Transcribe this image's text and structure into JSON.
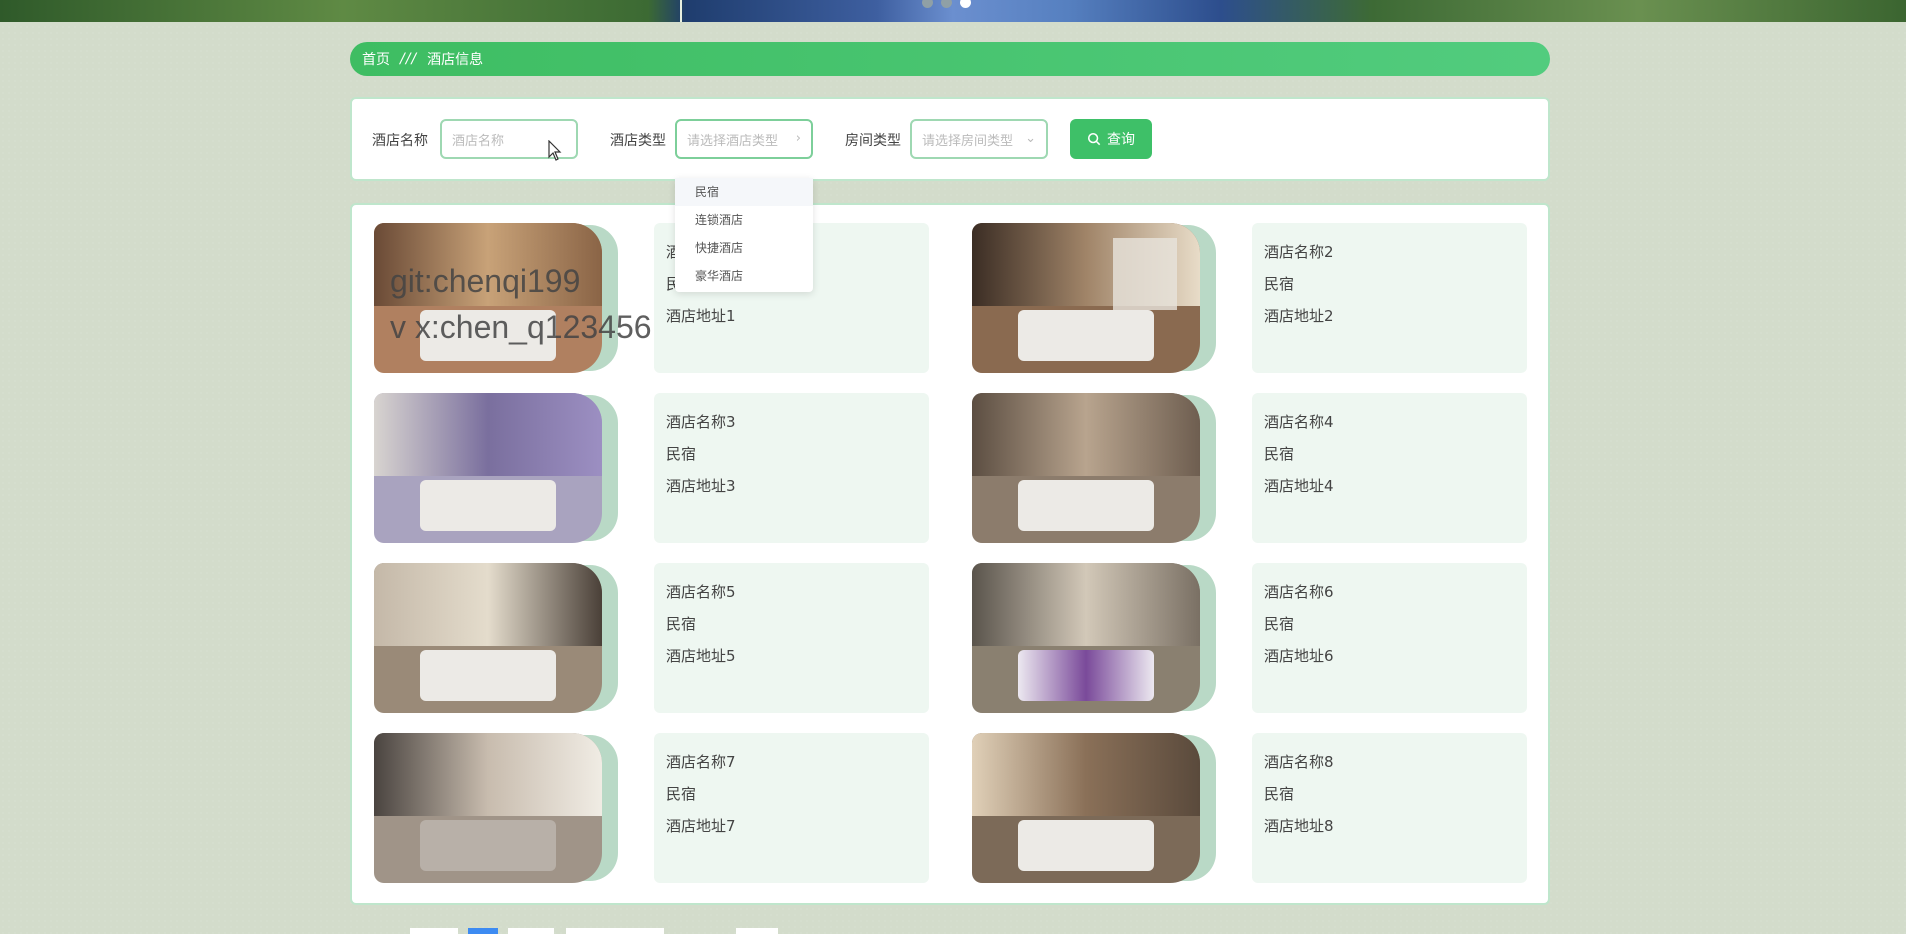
{
  "breadcrumb": {
    "home": "首页",
    "separator": "///",
    "current": "酒店信息"
  },
  "search": {
    "hotel_name_label": "酒店名称",
    "hotel_name_placeholder": "酒店名称",
    "hotel_type_label": "酒店类型",
    "hotel_type_placeholder": "请选择酒店类型",
    "room_type_label": "房间类型",
    "room_type_placeholder": "请选择房间类型",
    "query_button": "查询"
  },
  "hotel_type_options": [
    "民宿",
    "连锁酒店",
    "快捷酒店",
    "豪华酒店"
  ],
  "watermark": {
    "line1": "git:chenqi199",
    "line2": "v x:chen_q123456"
  },
  "hotels": [
    {
      "name": "酒店名称1",
      "type": "民宿",
      "address": "酒店地址1"
    },
    {
      "name": "酒店名称2",
      "type": "民宿",
      "address": "酒店地址2"
    },
    {
      "name": "酒店名称3",
      "type": "民宿",
      "address": "酒店地址3"
    },
    {
      "name": "酒店名称4",
      "type": "民宿",
      "address": "酒店地址4"
    },
    {
      "name": "酒店名称5",
      "type": "民宿",
      "address": "酒店地址5"
    },
    {
      "name": "酒店名称6",
      "type": "民宿",
      "address": "酒店地址6"
    },
    {
      "name": "酒店名称7",
      "type": "民宿",
      "address": "酒店地址7"
    },
    {
      "name": "酒店名称8",
      "type": "民宿",
      "address": "酒店地址8"
    }
  ],
  "colors": {
    "accent": "#3ec068",
    "panel_border": "#bfe6cc",
    "info_bg": "#eef7f1"
  }
}
